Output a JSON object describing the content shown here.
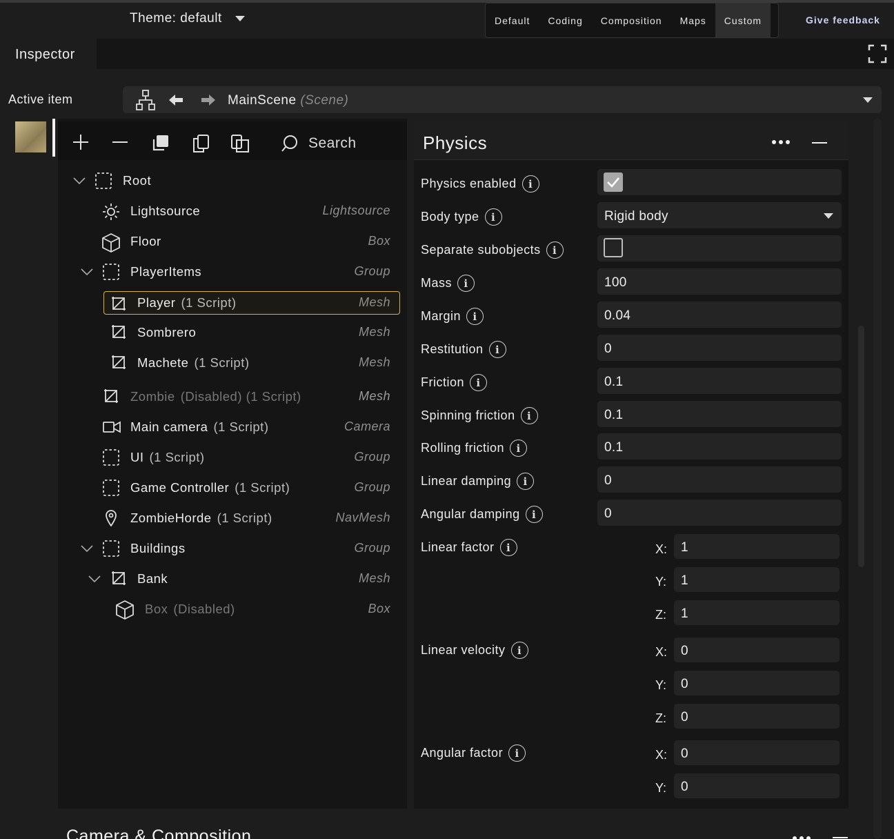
{
  "topbar": {
    "theme_label": "Theme: default",
    "layouts": [
      "Default",
      "Coding",
      "Composition",
      "Maps",
      "Custom"
    ],
    "active_layout": "Custom",
    "feedback_label": "Give feedback"
  },
  "panel_tab": "Inspector",
  "active_item": {
    "label": "Active item",
    "scene_name": "MainScene",
    "scene_type": "(Scene)"
  },
  "tree": {
    "search_label": "Search",
    "nodes": [
      {
        "name": "Root",
        "extra": "",
        "type": ""
      },
      {
        "name": "Lightsource",
        "extra": "",
        "type": "Lightsource"
      },
      {
        "name": "Floor",
        "extra": "",
        "type": "Box"
      },
      {
        "name": "PlayerItems",
        "extra": "",
        "type": "Group"
      },
      {
        "name": "Player",
        "extra": "(1 Script)",
        "type": "Mesh"
      },
      {
        "name": "Sombrero",
        "extra": "",
        "type": "Mesh"
      },
      {
        "name": "Machete",
        "extra": "(1 Script)",
        "type": "Mesh"
      },
      {
        "name": "Zombie",
        "extra": "(Disabled)  (1 Script)",
        "type": "Mesh"
      },
      {
        "name": "Main camera",
        "extra": "(1 Script)",
        "type": "Camera"
      },
      {
        "name": "UI",
        "extra": "(1 Script)",
        "type": "Group"
      },
      {
        "name": "Game Controller",
        "extra": "(1 Script)",
        "type": "Group"
      },
      {
        "name": "ZombieHorde",
        "extra": "(1 Script)",
        "type": "NavMesh"
      },
      {
        "name": "Buildings",
        "extra": "",
        "type": "Group"
      },
      {
        "name": "Bank",
        "extra": "",
        "type": "Mesh"
      },
      {
        "name": "Box",
        "extra": "(Disabled)",
        "type": "Box"
      }
    ]
  },
  "physics": {
    "title": "Physics",
    "rows": [
      {
        "label": "Physics enabled",
        "value": true
      },
      {
        "label": "Body type",
        "value": "Rigid body"
      },
      {
        "label": "Separate subobjects",
        "value": false
      },
      {
        "label": "Mass",
        "value": "100"
      },
      {
        "label": "Margin",
        "value": "0.04"
      },
      {
        "label": "Restitution",
        "value": "0"
      },
      {
        "label": "Friction",
        "value": "0.1"
      },
      {
        "label": "Spinning friction",
        "value": "0.1"
      },
      {
        "label": "Rolling friction",
        "value": "0.1"
      },
      {
        "label": "Linear damping",
        "value": "0"
      },
      {
        "label": "Angular damping",
        "value": "0"
      }
    ],
    "vectors": [
      {
        "label": "Linear factor",
        "x": "1",
        "y": "1",
        "z": "1"
      },
      {
        "label": "Linear velocity",
        "x": "0",
        "y": "0",
        "z": "0"
      },
      {
        "label": "Angular factor",
        "x": "0",
        "y": "0"
      }
    ],
    "axis_labels": {
      "x": "X:",
      "y": "Y:",
      "z": "Z:"
    }
  },
  "next_section_title": "Camera & Composition",
  "colors": {
    "selection": "#d4b53a",
    "background": "#1d1d1d",
    "field": "#242424"
  }
}
